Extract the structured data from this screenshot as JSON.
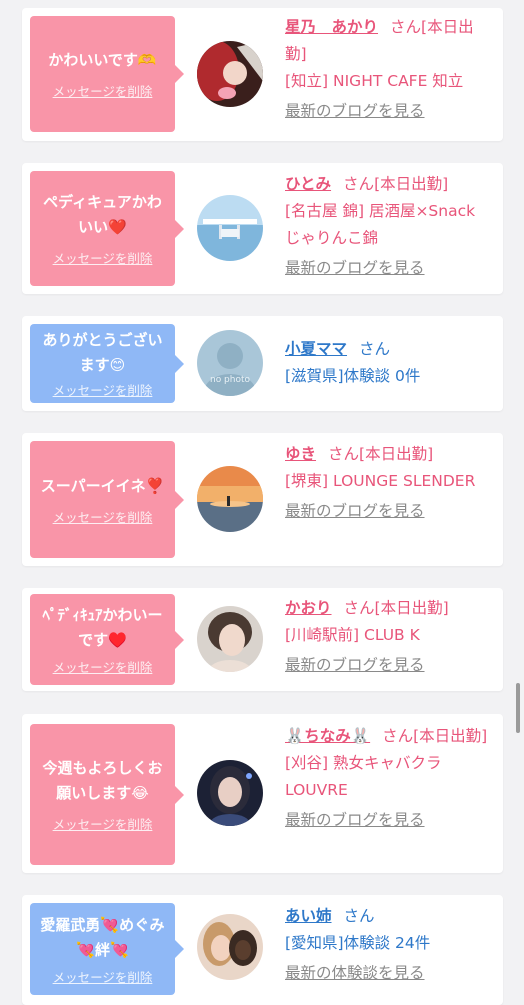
{
  "entries": [
    {
      "message": "かわいいです🫶",
      "delete_label": "メッセージを削除",
      "name": "星乃　あかり",
      "honorific": "さん",
      "status": "[本日出勤]",
      "shop": "[知立] NIGHT CAFE 知立",
      "link": "最新のブログを見る",
      "avatar": "woman-in-red-photo",
      "bubble_color": "#f995a8"
    },
    {
      "message": "ペディキュアかわいい❤️",
      "delete_label": "メッセージを削除",
      "name": "ひとみ",
      "honorific": "さん",
      "status": "[本日出勤]",
      "shop": "[名古屋 錦] 居酒屋×Snack じゃりんこ錦",
      "link": "最新のブログを見る",
      "avatar": "seaside-photo",
      "bubble_color": "#f995a8"
    },
    {
      "message": "ありがとうございます😊",
      "delete_label": "メッセージを削除",
      "name": "小夏ママ",
      "honorific": "さん",
      "shop": "[滋賀県]体験談 0件",
      "avatar": "no-photo-placeholder",
      "avatar_text": "no photo",
      "bubble_color": "#8fb8f6"
    },
    {
      "message": "スーパーイイネ❣️",
      "delete_label": "メッセージを削除",
      "name": "ゆき",
      "honorific": "さん",
      "status": "[本日出勤]",
      "shop": "[堺東] LOUNGE SLENDER",
      "link": "最新のブログを見る",
      "avatar": "sunset-sea-photo",
      "bubble_color": "#f995a8"
    },
    {
      "message": "ﾍﾟﾃﾞｨｷｭｱかわいーです♥️",
      "delete_label": "メッセージを削除",
      "name": "かおり",
      "honorific": "さん",
      "status": "[本日出勤]",
      "shop": "[川崎駅前] CLUB K",
      "link": "最新のブログを見る",
      "avatar": "short-hair-woman-photo",
      "bubble_color": "#f995a8"
    },
    {
      "message": "今週もよろしくお願いします😂",
      "delete_label": "メッセージを削除",
      "name": "🐰ちなみ🐰",
      "honorific": "さん",
      "status": "[本日出勤]",
      "shop": "[刈谷] 熟女キャバクラLOUVRE",
      "link": "最新のブログを見る",
      "avatar": "woman-dark-background-photo",
      "bubble_color": "#f995a8"
    },
    {
      "message": "愛羅武勇💘めぐみ💘絆💘",
      "delete_label": "メッセージを削除",
      "name": "あい姉",
      "honorific": "さん",
      "shop": "[愛知県]体験談 24件",
      "link": "最新の体験談を見る",
      "avatar": "group-selfie-photo",
      "bubble_color": "#8fb8f6"
    }
  ]
}
